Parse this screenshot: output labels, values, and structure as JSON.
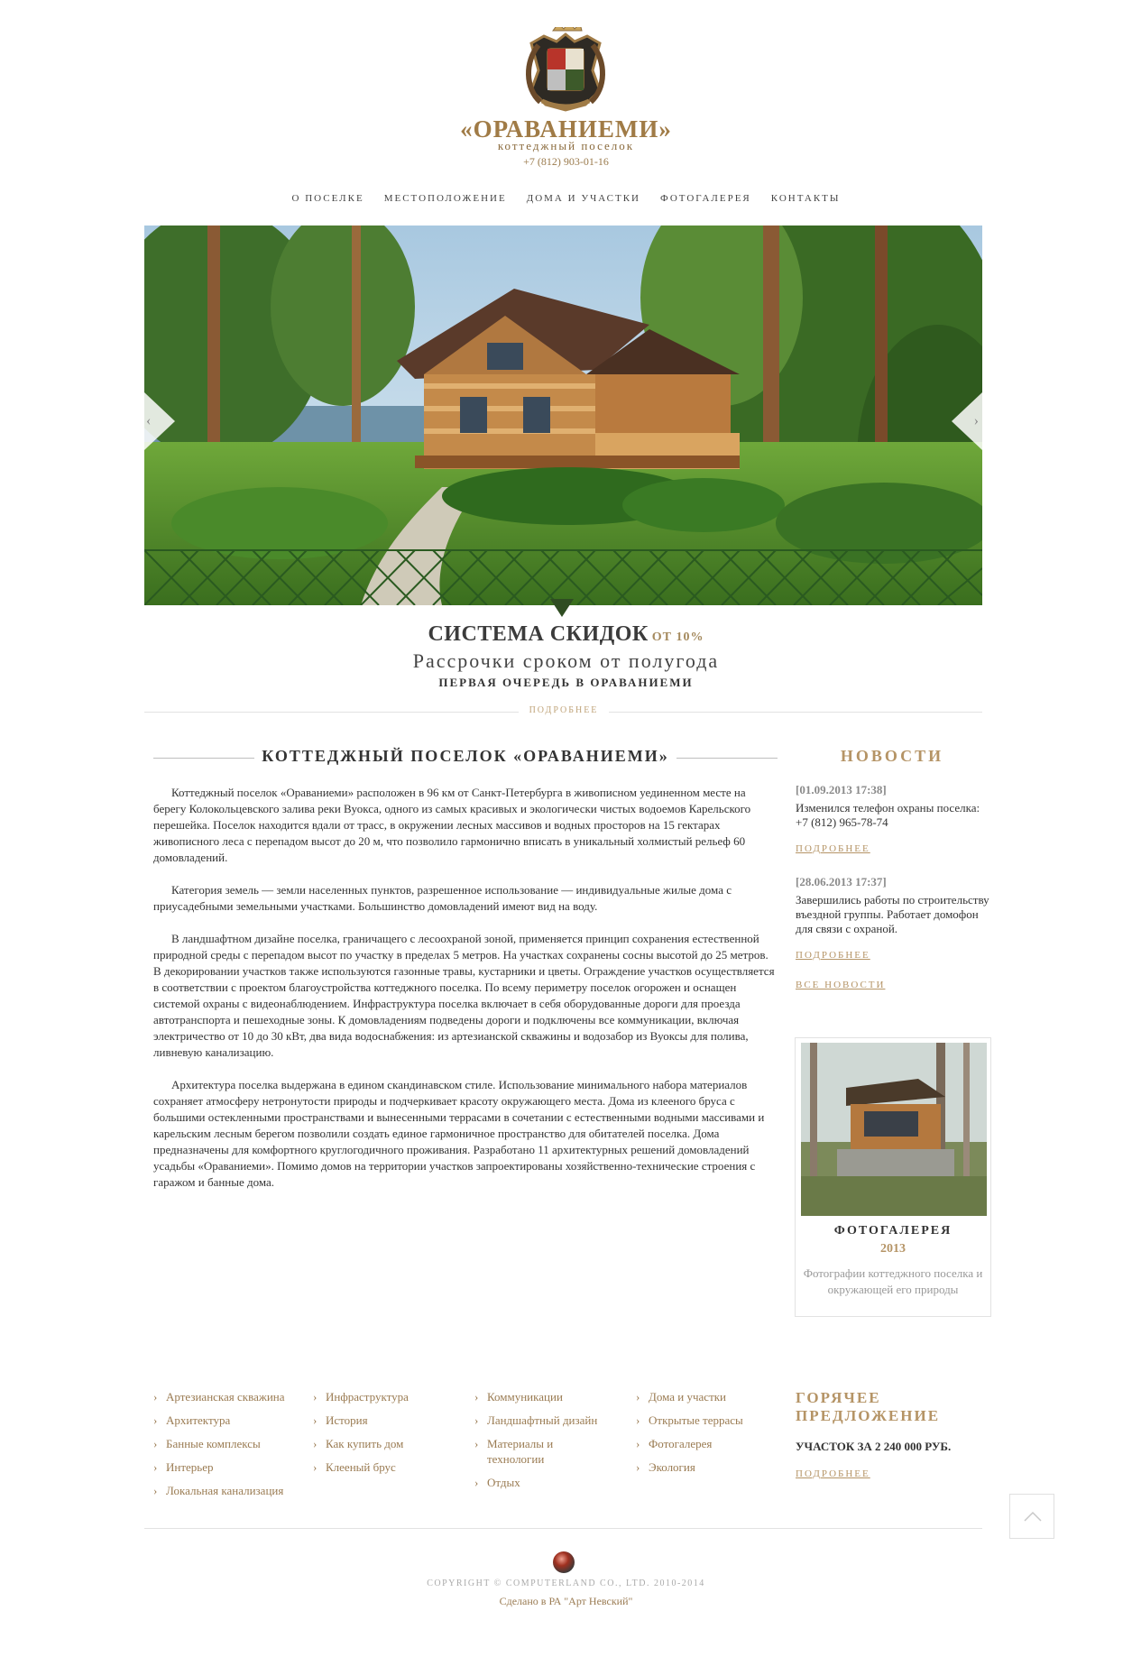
{
  "header": {
    "brand": "«ОРАВАНИЕМИ»",
    "tagline": "коттеджный поселок",
    "phone": "+7 (812) 903-01-16"
  },
  "nav": {
    "items": [
      "О ПОСЕЛКЕ",
      "МЕСТОПОЛОЖЕНИЕ",
      "ДОМА И УЧАСТКИ",
      "ФОТОГАЛЕРЕЯ",
      "КОНТАКТЫ"
    ]
  },
  "slider": {
    "prev_icon": "‹",
    "next_icon": "›"
  },
  "promo": {
    "title": "СИСТЕМА СКИДОК",
    "title_suffix": "ОТ 10%",
    "subtitle": "Рассрочки сроком от полугода",
    "subtitle2": "ПЕРВАЯ ОЧЕРЕДЬ В ОРАВАНИЕМИ",
    "more": "ПОДРОБНЕЕ"
  },
  "article": {
    "title": "КОТТЕДЖНЫЙ ПОСЕЛОК «ОРАВАНИЕМИ»",
    "paragraphs": [
      "Коттеджный поселок «Ораваниеми» расположен в 96 км от Санкт-Петербурга в живописном уединенном месте на берегу Колокольцевского залива реки Вуокса, одного из самых красивых и экологически чистых водоемов Карельского перешейка. Поселок находится вдали от трасс, в окружении лесных массивов и водных просторов на 15 гектарах живописного леса с перепадом высот до 20 м, что позволило гармонично вписать в уникальный холмистый рельеф 60 домовладений.",
      "Категория земель — земли населенных пунктов, разрешенное использование — индивидуальные жилые дома с приусадебными земельными участками. Большинство домовладений имеют вид на воду.",
      "В ландшафтном дизайне поселка, граничащего с лесоохраной зоной, применяется принцип сохранения естественной природной среды с перепадом высот по участку в пределах 5 метров. На участках сохранены сосны высотой до 25 метров. В декорировании участков также используются газонные травы, кустарники и цветы. Ограждение участков осуществляется в соответствии с проектом благоустройства коттеджного поселка. По всему периметру поселок огорожен и оснащен системой охраны  с видеонаблюдением. Инфраструктура поселка включает в себя оборудованные дороги для проезда автотранспорта и пешеходные зоны. К домовладениям подведены дороги и подключены все коммуникации, включая электричество от 10 до 30 кВт, два вида водоснабжения: из артезианской скважины и водозабор из Вуоксы для полива, ливневую канализацию.",
      "Архитектура поселка выдержана в едином скандинавском стиле. Использование минимального набора материалов сохраняет атмосферу нетронутости природы и подчеркивает красоту окружающего места. Дома из клееного бруса с большими остекленными пространствами и вынесенными террасами в сочетании с естественными водными массивами и карельским лесным берегом  позволили создать единое гармоничное пространство для обитателей поселка. Дома предназначены для комфортного круглогодичного проживания. Разработано 11 архитектурных решений домовладений усадьбы «Ораваниеми». Помимо домов на территории участков запроектированы хозяйственно-технические строения с гаражом и банные дома."
    ]
  },
  "news": {
    "title": "НОВОСТИ",
    "items": [
      {
        "date": "[01.09.2013 17:38]",
        "text": "Изменился телефон охраны поселка: +7 (812) 965-78-74",
        "more": "ПОДРОБНЕЕ"
      },
      {
        "date": "[28.06.2013 17:37]",
        "text": "Завершились работы по строительству въездной группы. Работает домофон для связи с охраной.",
        "more": "ПОДРОБНЕЕ"
      }
    ],
    "all": "ВСЕ НОВОСТИ"
  },
  "gallery": {
    "title": "ФОТОГАЛЕРЕЯ",
    "year": "2013",
    "desc": "Фотографии коттеджного поселка и окружающей его природы"
  },
  "footer": {
    "col1": [
      "Артезианская скважина",
      "Архитектура",
      "Банные комплексы",
      "Интерьер",
      "Локальная канализация"
    ],
    "col2": [
      "Инфраструктура",
      "История",
      "Как купить дом",
      "Клееный брус"
    ],
    "col3": [
      "Коммуникации",
      "Ландшафтный дизайн",
      "Материалы и технологии",
      "Отдых"
    ],
    "col4": [
      "Дома и участки",
      "Открытые террасы",
      "Фотогалерея",
      "Экология"
    ],
    "hot_title": "ГОРЯЧЕЕ ПРЕДЛОЖЕНИЕ",
    "hot_text": "УЧАСТОК ЗА 2 240 000 РУБ.",
    "hot_more": "ПОДРОБНЕЕ",
    "copyright": "COPYRIGHT © COMPUTERLAND CO., LTD. 2010-2014",
    "credit": "Сделано в РА \"Арт Невский\""
  },
  "colors": {
    "accent": "#b59466",
    "brand": "#a07b46",
    "text": "#333333"
  }
}
